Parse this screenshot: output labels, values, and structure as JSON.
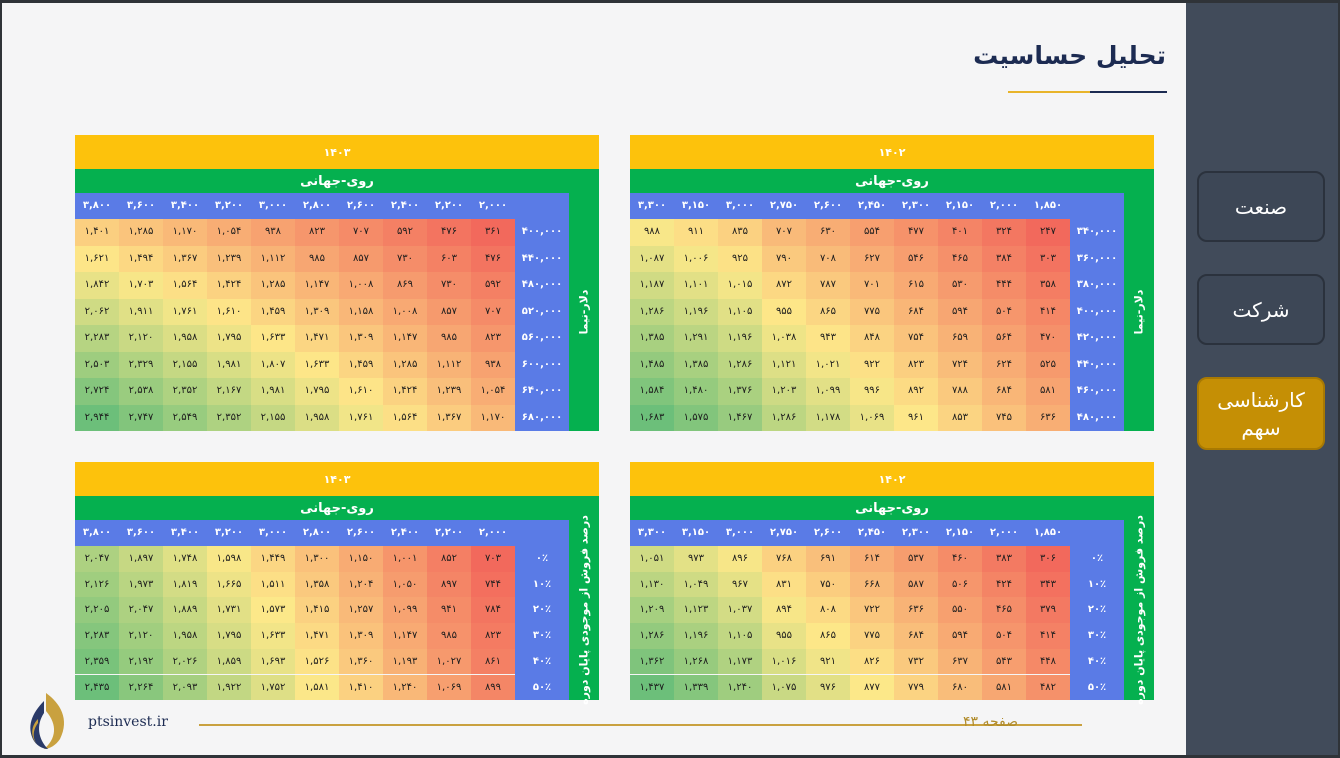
{
  "title": "تحلیل حساسیت",
  "sidebar": {
    "items": [
      {
        "label": "صنعت",
        "active": false
      },
      {
        "label": "شرکت",
        "active": false
      },
      {
        "label": "کارشناسی سهم",
        "active": true
      }
    ]
  },
  "colors": {
    "year_header": "#fdc20c",
    "sub_header": "#05b04f",
    "axis_header": "#5a7be6",
    "heat_low": "#f2695c",
    "heat_mid": "#fde889",
    "heat_high": "#6cbf7a",
    "sidebar_active": "#c58f05"
  },
  "tables": [
    {
      "year": "۱۴۰۲",
      "col_header": "روی-جهانی",
      "row_header": "دلار-نیما",
      "columns": [
        "۱,۸۵۰",
        "۲,۰۰۰",
        "۲,۱۵۰",
        "۲,۳۰۰",
        "۲,۴۵۰",
        "۲,۶۰۰",
        "۲,۷۵۰",
        "۳,۰۰۰",
        "۳,۱۵۰",
        "۳,۳۰۰"
      ],
      "rows": [
        "۳۴۰,۰۰۰",
        "۳۶۰,۰۰۰",
        "۳۸۰,۰۰۰",
        "۴۰۰,۰۰۰",
        "۴۲۰,۰۰۰",
        "۴۴۰,۰۰۰",
        "۴۶۰,۰۰۰",
        "۴۸۰,۰۰۰"
      ],
      "values": [
        [
          "۲۴۷",
          "۳۲۴",
          "۴۰۱",
          "۴۷۷",
          "۵۵۴",
          "۶۳۰",
          "۷۰۷",
          "۸۳۵",
          "۹۱۱",
          "۹۸۸"
        ],
        [
          "۳۰۳",
          "۳۸۴",
          "۴۶۵",
          "۵۴۶",
          "۶۲۷",
          "۷۰۸",
          "۷۹۰",
          "۹۲۵",
          "۱,۰۰۶",
          "۱,۰۸۷"
        ],
        [
          "۳۵۸",
          "۴۴۴",
          "۵۳۰",
          "۶۱۵",
          "۷۰۱",
          "۷۸۷",
          "۸۷۲",
          "۱,۰۱۵",
          "۱,۱۰۱",
          "۱,۱۸۷"
        ],
        [
          "۴۱۴",
          "۵۰۴",
          "۵۹۴",
          "۶۸۴",
          "۷۷۵",
          "۸۶۵",
          "۹۵۵",
          "۱,۱۰۵",
          "۱,۱۹۶",
          "۱,۲۸۶"
        ],
        [
          "۴۷۰",
          "۵۶۴",
          "۶۵۹",
          "۷۵۴",
          "۸۴۸",
          "۹۴۳",
          "۱,۰۳۸",
          "۱,۱۹۶",
          "۱,۲۹۱",
          "۱,۳۸۵"
        ],
        [
          "۵۲۵",
          "۶۲۴",
          "۷۲۴",
          "۸۲۳",
          "۹۲۲",
          "۱,۰۲۱",
          "۱,۱۲۱",
          "۱,۲۸۶",
          "۱,۳۸۵",
          "۱,۴۸۵"
        ],
        [
          "۵۸۱",
          "۶۸۴",
          "۷۸۸",
          "۸۹۲",
          "۹۹۶",
          "۱,۰۹۹",
          "۱,۲۰۳",
          "۱,۳۷۶",
          "۱,۴۸۰",
          "۱,۵۸۴"
        ],
        [
          "۶۳۶",
          "۷۴۵",
          "۸۵۳",
          "۹۶۱",
          "۱,۰۶۹",
          "۱,۱۷۸",
          "۱,۲۸۶",
          "۱,۴۶۷",
          "۱,۵۷۵",
          "۱,۶۸۳"
        ]
      ]
    },
    {
      "year": "۱۴۰۳",
      "col_header": "روی-جهانی",
      "row_header": "دلار-نیما",
      "columns": [
        "۲,۰۰۰",
        "۲,۲۰۰",
        "۲,۴۰۰",
        "۲,۶۰۰",
        "۲,۸۰۰",
        "۳,۰۰۰",
        "۳,۲۰۰",
        "۳,۴۰۰",
        "۳,۶۰۰",
        "۳,۸۰۰"
      ],
      "rows": [
        "۴۰۰,۰۰۰",
        "۴۴۰,۰۰۰",
        "۴۸۰,۰۰۰",
        "۵۲۰,۰۰۰",
        "۵۶۰,۰۰۰",
        "۶۰۰,۰۰۰",
        "۶۴۰,۰۰۰",
        "۶۸۰,۰۰۰"
      ],
      "values": [
        [
          "۳۶۱",
          "۴۷۶",
          "۵۹۲",
          "۷۰۷",
          "۸۲۳",
          "۹۳۸",
          "۱,۰۵۴",
          "۱,۱۷۰",
          "۱,۲۸۵",
          "۱,۴۰۱"
        ],
        [
          "۴۷۶",
          "۶۰۳",
          "۷۳۰",
          "۸۵۷",
          "۹۸۵",
          "۱,۱۱۲",
          "۱,۲۳۹",
          "۱,۳۶۷",
          "۱,۴۹۴",
          "۱,۶۲۱"
        ],
        [
          "۵۹۲",
          "۷۳۰",
          "۸۶۹",
          "۱,۰۰۸",
          "۱,۱۴۷",
          "۱,۲۸۵",
          "۱,۴۲۴",
          "۱,۵۶۴",
          "۱,۷۰۳",
          "۱,۸۴۲"
        ],
        [
          "۷۰۷",
          "۸۵۷",
          "۱,۰۰۸",
          "۱,۱۵۸",
          "۱,۳۰۹",
          "۱,۴۵۹",
          "۱,۶۱۰",
          "۱,۷۶۱",
          "۱,۹۱۱",
          "۲,۰۶۲"
        ],
        [
          "۸۲۳",
          "۹۸۵",
          "۱,۱۴۷",
          "۱,۳۰۹",
          "۱,۴۷۱",
          "۱,۶۳۳",
          "۱,۷۹۵",
          "۱,۹۵۸",
          "۲,۱۲۰",
          "۲,۲۸۳"
        ],
        [
          "۹۳۸",
          "۱,۱۱۲",
          "۱,۲۸۵",
          "۱,۴۵۹",
          "۱,۶۳۳",
          "۱,۸۰۷",
          "۱,۹۸۱",
          "۲,۱۵۵",
          "۲,۳۲۹",
          "۲,۵۰۳"
        ],
        [
          "۱,۰۵۴",
          "۱,۲۳۹",
          "۱,۴۲۴",
          "۱,۶۱۰",
          "۱,۷۹۵",
          "۱,۹۸۱",
          "۲,۱۶۷",
          "۲,۳۵۲",
          "۲,۵۳۸",
          "۲,۷۲۴"
        ],
        [
          "۱,۱۷۰",
          "۱,۳۶۷",
          "۱,۵۶۴",
          "۱,۷۶۱",
          "۱,۹۵۸",
          "۲,۱۵۵",
          "۲,۳۵۲",
          "۲,۵۴۹",
          "۲,۷۴۷",
          "۲,۹۴۴"
        ]
      ]
    },
    {
      "year": "۱۴۰۲",
      "col_header": "روی-جهانی",
      "row_header": "درصد فروش از موجودی پایان دوره",
      "columns": [
        "۱,۸۵۰",
        "۲,۰۰۰",
        "۲,۱۵۰",
        "۲,۳۰۰",
        "۲,۴۵۰",
        "۲,۶۰۰",
        "۲,۷۵۰",
        "۳,۰۰۰",
        "۳,۱۵۰",
        "۳,۳۰۰"
      ],
      "rows": [
        "۰٪",
        "۱۰٪",
        "۲۰٪",
        "۳۰٪",
        "۴۰٪",
        "۵۰٪"
      ],
      "values": [
        [
          "۳۰۶",
          "۳۸۳",
          "۴۶۰",
          "۵۳۷",
          "۶۱۴",
          "۶۹۱",
          "۷۶۸",
          "۸۹۶",
          "۹۷۳",
          "۱,۰۵۱"
        ],
        [
          "۳۴۳",
          "۴۲۴",
          "۵۰۶",
          "۵۸۷",
          "۶۶۸",
          "۷۵۰",
          "۸۳۱",
          "۹۶۷",
          "۱,۰۴۹",
          "۱,۱۳۰"
        ],
        [
          "۳۷۹",
          "۴۶۵",
          "۵۵۰",
          "۶۳۶",
          "۷۲۲",
          "۸۰۸",
          "۸۹۴",
          "۱,۰۳۷",
          "۱,۱۲۳",
          "۱,۲۰۹"
        ],
        [
          "۴۱۴",
          "۵۰۴",
          "۵۹۴",
          "۶۸۴",
          "۷۷۵",
          "۸۶۵",
          "۹۵۵",
          "۱,۱۰۵",
          "۱,۱۹۶",
          "۱,۲۸۶"
        ],
        [
          "۴۴۸",
          "۵۴۳",
          "۶۳۷",
          "۷۳۲",
          "۸۲۶",
          "۹۲۱",
          "۱,۰۱۶",
          "۱,۱۷۳",
          "۱,۲۶۸",
          "۱,۳۶۲"
        ],
        [
          "۴۸۲",
          "۵۸۱",
          "۶۸۰",
          "۷۷۹",
          "۸۷۷",
          "۹۷۶",
          "۱,۰۷۵",
          "۱,۲۴۰",
          "۱,۳۳۹",
          "۱,۴۳۷"
        ]
      ]
    },
    {
      "year": "۱۴۰۳",
      "col_header": "روی-جهانی",
      "row_header": "درصد فروش از موجودی پایان دوره",
      "columns": [
        "۲,۰۰۰",
        "۲,۲۰۰",
        "۲,۴۰۰",
        "۲,۶۰۰",
        "۲,۸۰۰",
        "۳,۰۰۰",
        "۳,۲۰۰",
        "۳,۴۰۰",
        "۳,۶۰۰",
        "۳,۸۰۰"
      ],
      "rows": [
        "۰٪",
        "۱۰٪",
        "۲۰٪",
        "۳۰٪",
        "۴۰٪",
        "۵۰٪"
      ],
      "values": [
        [
          "۷۰۳",
          "۸۵۲",
          "۱,۰۰۱",
          "۱,۱۵۰",
          "۱,۳۰۰",
          "۱,۴۴۹",
          "۱,۵۹۸",
          "۱,۷۴۸",
          "۱,۸۹۷",
          "۲,۰۴۷"
        ],
        [
          "۷۴۴",
          "۸۹۷",
          "۱,۰۵۰",
          "۱,۲۰۴",
          "۱,۳۵۸",
          "۱,۵۱۱",
          "۱,۶۶۵",
          "۱,۸۱۹",
          "۱,۹۷۳",
          "۲,۱۲۶"
        ],
        [
          "۷۸۴",
          "۹۴۱",
          "۱,۰۹۹",
          "۱,۲۵۷",
          "۱,۴۱۵",
          "۱,۵۷۳",
          "۱,۷۳۱",
          "۱,۸۸۹",
          "۲,۰۴۷",
          "۲,۲۰۵"
        ],
        [
          "۸۲۳",
          "۹۸۵",
          "۱,۱۴۷",
          "۱,۳۰۹",
          "۱,۴۷۱",
          "۱,۶۳۳",
          "۱,۷۹۵",
          "۱,۹۵۸",
          "۲,۱۲۰",
          "۲,۲۸۳"
        ],
        [
          "۸۶۱",
          "۱,۰۲۷",
          "۱,۱۹۳",
          "۱,۳۶۰",
          "۱,۵۲۶",
          "۱,۶۹۳",
          "۱,۸۵۹",
          "۲,۰۲۶",
          "۲,۱۹۲",
          "۲,۳۵۹"
        ],
        [
          "۸۹۹",
          "۱,۰۶۹",
          "۱,۲۴۰",
          "۱,۴۱۰",
          "۱,۵۸۱",
          "۱,۷۵۲",
          "۱,۹۲۲",
          "۲,۰۹۳",
          "۲,۲۶۴",
          "۲,۴۳۵"
        ]
      ]
    }
  ],
  "footer": {
    "site": "ptsinvest.ir",
    "page_label": "صفحه ۴۳"
  }
}
